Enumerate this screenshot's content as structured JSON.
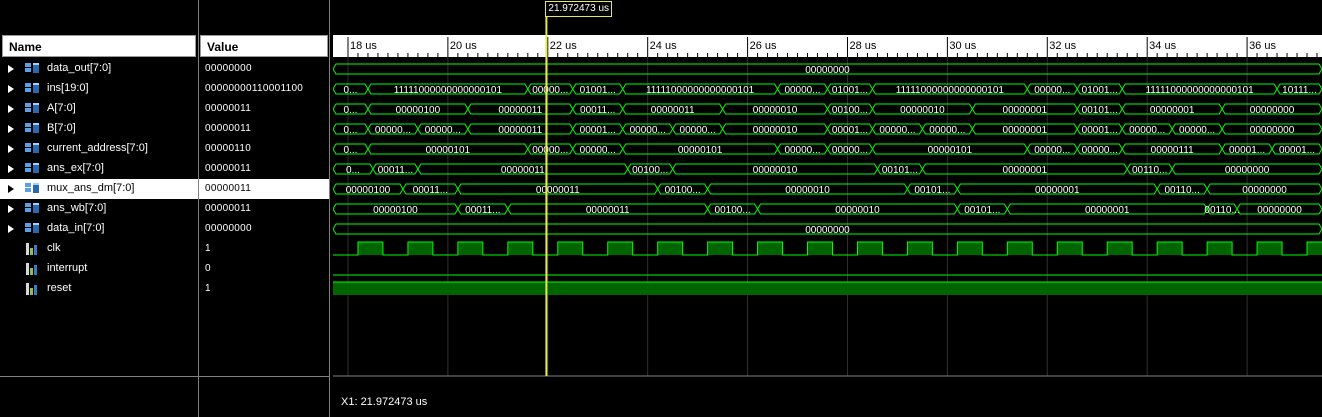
{
  "headers": {
    "name": "Name",
    "value": "Value"
  },
  "cursor": {
    "time_label": "21.972473 us",
    "readout": "X1: 21.972473 us",
    "time_us": 21.972473
  },
  "signals": [
    {
      "name": "data_out[7:0]",
      "value": "00000000",
      "kind": "bus",
      "expandable": true
    },
    {
      "name": "ins[19:0]",
      "value": "00000000110001100",
      "kind": "bus",
      "expandable": true
    },
    {
      "name": "A[7:0]",
      "value": "00000011",
      "kind": "bus",
      "expandable": true
    },
    {
      "name": "B[7:0]",
      "value": "00000011",
      "kind": "bus",
      "expandable": true
    },
    {
      "name": "current_address[7:0]",
      "value": "00000110",
      "kind": "bus",
      "expandable": true
    },
    {
      "name": "ans_ex[7:0]",
      "value": "00000011",
      "kind": "bus",
      "expandable": true
    },
    {
      "name": "mux_ans_dm[7:0]",
      "value": "00000011",
      "kind": "bus",
      "expandable": true,
      "selected": true
    },
    {
      "name": "ans_wb[7:0]",
      "value": "00000011",
      "kind": "bus",
      "expandable": true
    },
    {
      "name": "data_in[7:0]",
      "value": "00000000",
      "kind": "bus",
      "expandable": true
    },
    {
      "name": "clk",
      "value": "1",
      "kind": "bit",
      "expandable": false
    },
    {
      "name": "interrupt",
      "value": "0",
      "kind": "bit",
      "expandable": false
    },
    {
      "name": "reset",
      "value": "1",
      "kind": "bit",
      "expandable": false
    }
  ],
  "timeline": {
    "start_us": 17.7,
    "end_us": 37.5,
    "ticks": [
      "18 us",
      "20 us",
      "22 us",
      "24 us",
      "26 us",
      "28 us",
      "30 us",
      "32 us",
      "34 us",
      "36 us"
    ],
    "tick_values": [
      18,
      20,
      22,
      24,
      26,
      28,
      30,
      32,
      34,
      36
    ]
  },
  "bus_waves": [
    {
      "segments": [
        {
          "t": 17.7,
          "label": "00000000"
        }
      ]
    },
    {
      "segments": [
        {
          "t": 17.7,
          "label": "0..."
        },
        {
          "t": 18.4,
          "label": "11111000000000000101"
        },
        {
          "t": 21.6,
          "label": "00000..."
        },
        {
          "t": 22.5,
          "label": "01001..."
        },
        {
          "t": 23.5,
          "label": "11111000000000000101"
        },
        {
          "t": 26.6,
          "label": "00000..."
        },
        {
          "t": 27.6,
          "label": "01001..."
        },
        {
          "t": 28.5,
          "label": "11111000000000000101"
        },
        {
          "t": 31.6,
          "label": "00000..."
        },
        {
          "t": 32.6,
          "label": "01001..."
        },
        {
          "t": 33.5,
          "label": "11111000000000000101"
        },
        {
          "t": 36.6,
          "label": "10111..."
        }
      ]
    },
    {
      "segments": [
        {
          "t": 17.7,
          "label": "0..."
        },
        {
          "t": 18.4,
          "label": "00000100"
        },
        {
          "t": 20.4,
          "label": "00000011"
        },
        {
          "t": 22.5,
          "label": "00011..."
        },
        {
          "t": 23.5,
          "label": "00000011"
        },
        {
          "t": 25.5,
          "label": "00000010"
        },
        {
          "t": 27.6,
          "label": "00100..."
        },
        {
          "t": 28.5,
          "label": "00000010"
        },
        {
          "t": 30.5,
          "label": "00000001"
        },
        {
          "t": 32.6,
          "label": "00101..."
        },
        {
          "t": 33.5,
          "label": "00000001"
        },
        {
          "t": 35.5,
          "label": "00000000"
        }
      ]
    },
    {
      "segments": [
        {
          "t": 17.7,
          "label": "0..."
        },
        {
          "t": 18.4,
          "label": "00000..."
        },
        {
          "t": 19.4,
          "label": "00000..."
        },
        {
          "t": 20.4,
          "label": "00000011"
        },
        {
          "t": 22.5,
          "label": "00001..."
        },
        {
          "t": 23.5,
          "label": "00000..."
        },
        {
          "t": 24.5,
          "label": "00000..."
        },
        {
          "t": 25.5,
          "label": "00000010"
        },
        {
          "t": 27.6,
          "label": "00001..."
        },
        {
          "t": 28.5,
          "label": "00000..."
        },
        {
          "t": 29.5,
          "label": "00000..."
        },
        {
          "t": 30.5,
          "label": "00000001"
        },
        {
          "t": 32.6,
          "label": "00001..."
        },
        {
          "t": 33.5,
          "label": "00000..."
        },
        {
          "t": 34.5,
          "label": "00000..."
        },
        {
          "t": 35.5,
          "label": "00000000"
        }
      ]
    },
    {
      "segments": [
        {
          "t": 17.7,
          "label": "0..."
        },
        {
          "t": 18.4,
          "label": "00000101"
        },
        {
          "t": 21.6,
          "label": "00000..."
        },
        {
          "t": 22.5,
          "label": "00000..."
        },
        {
          "t": 23.5,
          "label": "00000101"
        },
        {
          "t": 26.6,
          "label": "00000..."
        },
        {
          "t": 27.6,
          "label": "00000..."
        },
        {
          "t": 28.5,
          "label": "00000101"
        },
        {
          "t": 31.6,
          "label": "00000..."
        },
        {
          "t": 32.6,
          "label": "00000..."
        },
        {
          "t": 33.5,
          "label": "00000111"
        },
        {
          "t": 35.5,
          "label": "00001..."
        },
        {
          "t": 36.5,
          "label": "00001..."
        }
      ]
    },
    {
      "segments": [
        {
          "t": 17.7,
          "label": "0..."
        },
        {
          "t": 18.5,
          "label": "00011..."
        },
        {
          "t": 19.4,
          "label": "00000011"
        },
        {
          "t": 23.6,
          "label": "00100..."
        },
        {
          "t": 24.5,
          "label": "00000010"
        },
        {
          "t": 28.6,
          "label": "00101..."
        },
        {
          "t": 29.5,
          "label": "00000001"
        },
        {
          "t": 33.6,
          "label": "00110..."
        },
        {
          "t": 34.5,
          "label": "00000000"
        }
      ]
    },
    {
      "segments": [
        {
          "t": 17.7,
          "label": "00000100"
        },
        {
          "t": 19.1,
          "label": "00011..."
        },
        {
          "t": 20.2,
          "label": "00000011"
        },
        {
          "t": 24.2,
          "label": "00100..."
        },
        {
          "t": 25.2,
          "label": "00000010"
        },
        {
          "t": 29.2,
          "label": "00101..."
        },
        {
          "t": 30.2,
          "label": "00000001"
        },
        {
          "t": 34.2,
          "label": "00110..."
        },
        {
          "t": 35.2,
          "label": "00000000"
        }
      ]
    },
    {
      "segments": [
        {
          "t": 17.7,
          "label": "00000100"
        },
        {
          "t": 20.2,
          "label": "00011..."
        },
        {
          "t": 21.2,
          "label": "00000011"
        },
        {
          "t": 25.2,
          "label": "00100..."
        },
        {
          "t": 26.2,
          "label": "00000010"
        },
        {
          "t": 30.2,
          "label": "00101..."
        },
        {
          "t": 31.2,
          "label": "00000001"
        },
        {
          "t": 35.2,
          "label": "00110..."
        },
        {
          "t": 35.8,
          "label": "00000000"
        }
      ]
    },
    {
      "segments": [
        {
          "t": 17.7,
          "label": "00000000"
        }
      ]
    }
  ],
  "clock": {
    "period_us": 1.0,
    "high_first_edge_us": 18.2,
    "duty": 0.5
  },
  "interrupt_level": 0,
  "reset_level": 1,
  "colors": {
    "wave": "#00ff00",
    "wave_fill": "#006400",
    "cursor": "#e8e850",
    "grid": "#303030",
    "label": "#ffffff"
  }
}
